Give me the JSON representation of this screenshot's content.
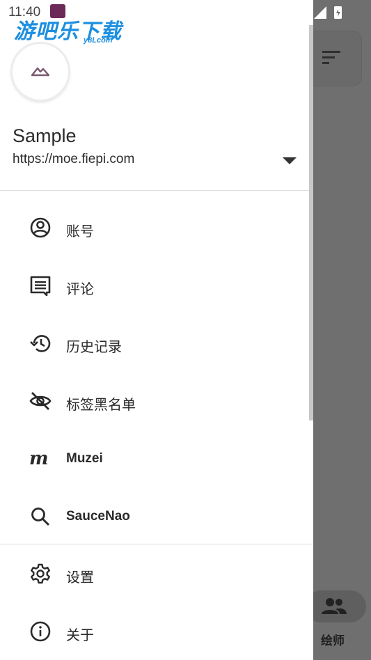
{
  "status_bar": {
    "time": "11:40"
  },
  "watermark": {
    "text": "游吧乐下载",
    "sub": "y8Lcom"
  },
  "account": {
    "name": "Sample",
    "url": "https://moe.fiepi.com"
  },
  "menu": {
    "items": [
      {
        "label": "账号",
        "icon": "account-circle-icon"
      },
      {
        "label": "评论",
        "icon": "comment-icon"
      },
      {
        "label": "历史记录",
        "icon": "history-icon"
      },
      {
        "label": "标签黑名单",
        "icon": "eye-off-icon"
      },
      {
        "label": "Muzei",
        "icon": "muzei-icon"
      },
      {
        "label": "SauceNao",
        "icon": "search-icon"
      }
    ],
    "secondary": [
      {
        "label": "设置",
        "icon": "gear-icon"
      },
      {
        "label": "关于",
        "icon": "info-icon"
      }
    ]
  },
  "background": {
    "bottom_nav_label": "绘师"
  },
  "colors": {
    "drawer_bg": "#ffffff",
    "scrim": "#6f6f6f",
    "text": "#2a2a2a",
    "watermark": "#1d8fe0"
  }
}
